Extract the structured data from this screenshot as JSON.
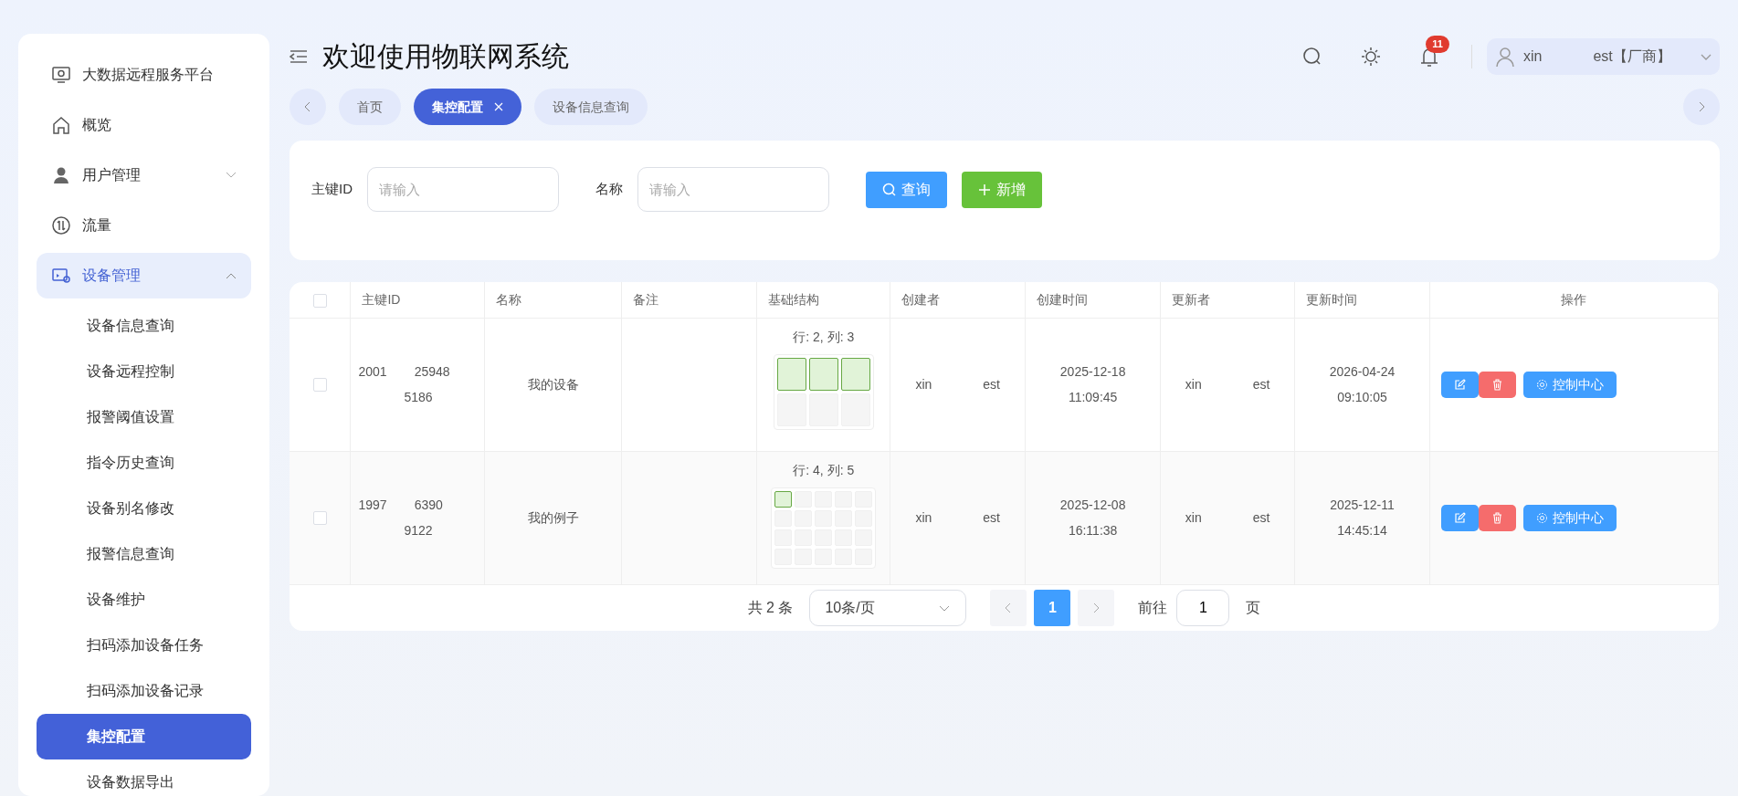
{
  "sidebar": {
    "items": [
      {
        "label": "大数据远程服务平台",
        "selected": false
      },
      {
        "label": "概览",
        "selected": false
      },
      {
        "label": "用户管理",
        "selected": false,
        "expanded": false
      },
      {
        "label": "流量",
        "selected": false
      },
      {
        "label": "设备管理",
        "selected": false,
        "expanded": true,
        "children": [
          {
            "label": "设备信息查询",
            "selected": false
          },
          {
            "label": "设备远程控制",
            "selected": false
          },
          {
            "label": "报警阈值设置",
            "selected": false
          },
          {
            "label": "指令历史查询",
            "selected": false
          },
          {
            "label": "设备别名修改",
            "selected": false
          },
          {
            "label": "报警信息查询",
            "selected": false
          },
          {
            "label": "设备维护",
            "selected": false
          },
          {
            "label": "扫码添加设备任务",
            "selected": false
          },
          {
            "label": "扫码添加设备记录",
            "selected": false
          },
          {
            "label": "集控配置",
            "selected": true
          },
          {
            "label": "设备数据导出",
            "selected": false
          }
        ]
      }
    ]
  },
  "header": {
    "title": "欢迎使用物联网系统",
    "notification_count": "11",
    "user_parts": [
      "xin",
      "est【厂商】"
    ]
  },
  "tabs": [
    {
      "label": "首页",
      "selected": false
    },
    {
      "label": "集控配置",
      "selected": true
    },
    {
      "label": "设备信息查询",
      "selected": false
    }
  ],
  "search": {
    "fields": [
      {
        "label": "主键ID",
        "placeholder": "请输入"
      },
      {
        "label": "名称",
        "placeholder": "请输入"
      }
    ],
    "buttons": [
      {
        "label": "查询",
        "kind": "search"
      },
      {
        "label": "新增",
        "kind": "add"
      }
    ]
  },
  "table": {
    "all_checked": false,
    "columns": [
      "主键ID",
      "名称",
      "备注",
      "基础结构",
      "创建者",
      "创建时间",
      "更新者",
      "更新时间",
      "操作"
    ],
    "rows": [
      {
        "checked": false,
        "id_parts": [
          "2001",
          "25948",
          "5186"
        ],
        "name": "我的设备",
        "structure_label": "行: 2, 列: 3",
        "grid": [
          [
            true,
            true,
            true
          ],
          [
            false,
            false,
            false
          ]
        ],
        "creator_parts": [
          "xin",
          "est"
        ],
        "created": [
          "2025-12-18",
          "11:09:45"
        ],
        "updater_parts": [
          "xin",
          "est"
        ],
        "updated": [
          "2026-04-24",
          "09:10:05"
        ],
        "action": "控制中心"
      },
      {
        "checked": false,
        "id_parts": [
          "1997",
          "6390",
          "9122"
        ],
        "name": "我的例子",
        "structure_label": "行: 4, 列: 5",
        "grid": [
          [
            true,
            false,
            false,
            false,
            false
          ],
          [
            false,
            false,
            false,
            false,
            false
          ],
          [
            false,
            false,
            false,
            false,
            false
          ],
          [
            false,
            false,
            false,
            false,
            false
          ]
        ],
        "creator_parts": [
          "xin",
          "est"
        ],
        "created": [
          "2025-12-08",
          "16:11:38"
        ],
        "updater_parts": [
          "xin",
          "est"
        ],
        "updated": [
          "2025-12-11",
          "14:45:14"
        ],
        "action": "控制中心"
      }
    ]
  },
  "pagination": {
    "total": "共 2 条",
    "page_size": "10条/页",
    "pages": [
      {
        "label": "1",
        "selected": true
      }
    ],
    "goto_label": "前往",
    "goto_value": "1",
    "page_suffix": "页"
  }
}
